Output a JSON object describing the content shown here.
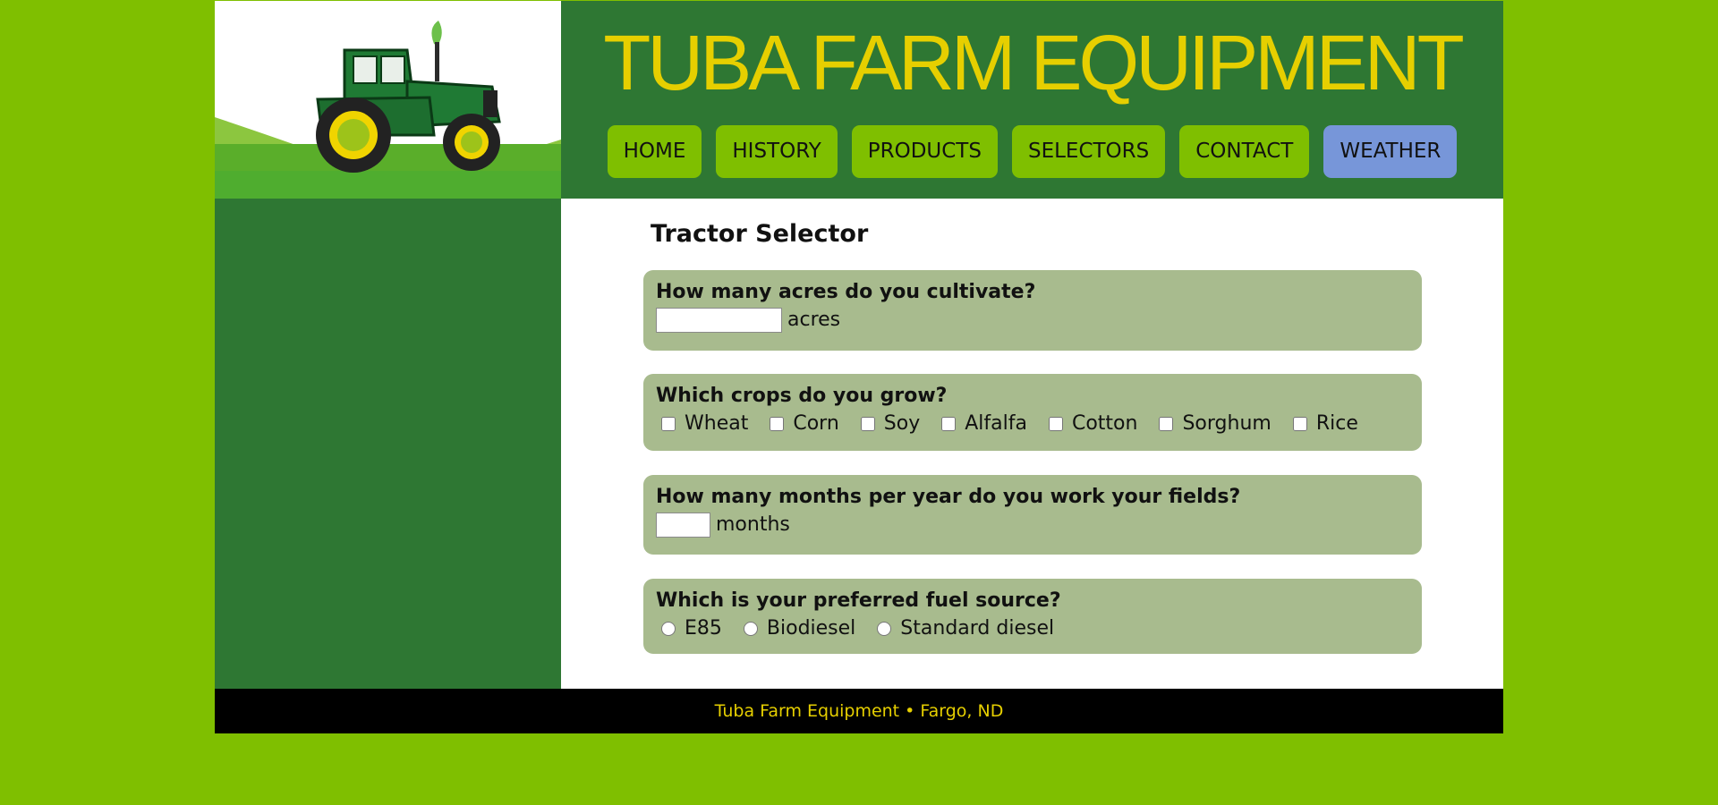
{
  "site": {
    "title": "TUBA FARM EQUIPMENT"
  },
  "nav": {
    "items": [
      {
        "label": "HOME"
      },
      {
        "label": "HISTORY"
      },
      {
        "label": "PRODUCTS"
      },
      {
        "label": "SELECTORS"
      },
      {
        "label": "CONTACT"
      },
      {
        "label": "WEATHER",
        "active": true
      }
    ]
  },
  "main": {
    "heading": "Tractor Selector",
    "questions": {
      "acres": {
        "label": "How many acres do you cultivate?",
        "value": "",
        "unit": "acres"
      },
      "crops": {
        "label": "Which crops do you grow?",
        "options": [
          "Wheat",
          "Corn",
          "Soy",
          "Alfalfa",
          "Cotton",
          "Sorghum",
          "Rice"
        ]
      },
      "months": {
        "label": "How many months per year do you work your fields?",
        "value": "",
        "unit": "months"
      },
      "fuel": {
        "label": "Which is your preferred fuel source?",
        "options": [
          "E85",
          "Biodiesel",
          "Standard diesel"
        ]
      }
    }
  },
  "footer": {
    "text": "Tuba Farm Equipment • Fargo, ND"
  },
  "icons": {
    "logo": "tractor-icon"
  },
  "colors": {
    "page_background": "#7fbf00",
    "header_green": "#2e7733",
    "title_yellow": "#e6cf00",
    "nav_button": "#7fbf00",
    "nav_active": "#7796d9",
    "card": "#a8bb8e",
    "footer_background": "#000000"
  }
}
